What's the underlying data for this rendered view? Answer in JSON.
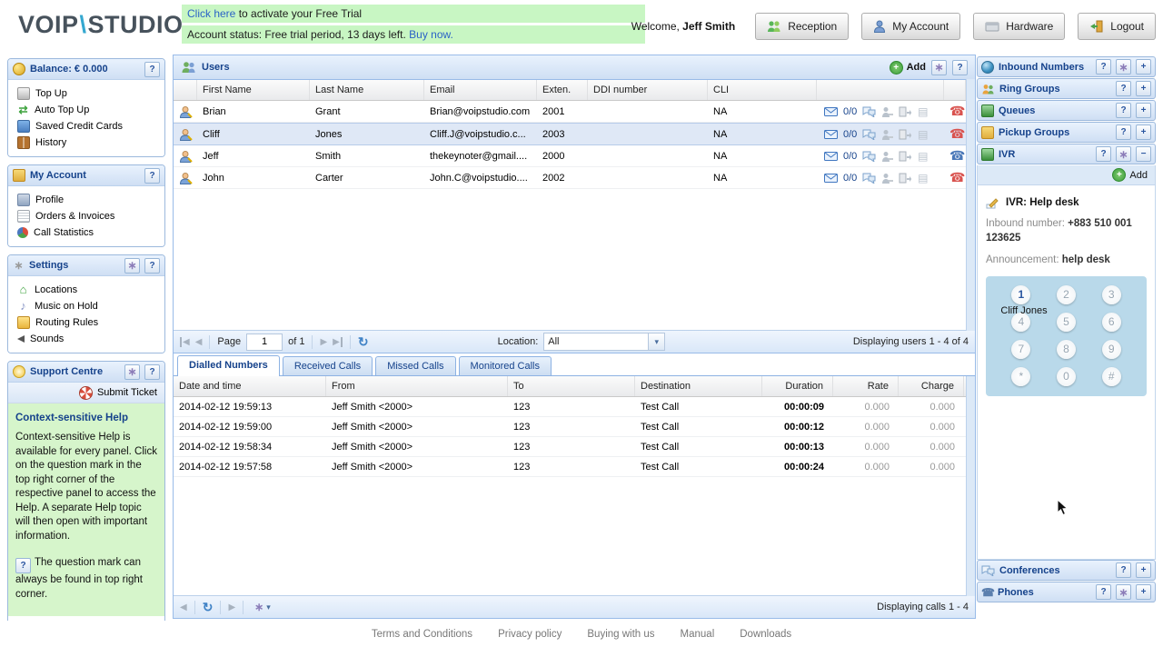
{
  "header": {
    "logo_voip": "VOIP",
    "logo_slash": "\\",
    "logo_studio": "STUDIO",
    "banner": {
      "line1_link": "Click here",
      "line1_rest": " to activate your Free Trial",
      "line2_text": "Account status: Free trial period, 13 days left.",
      "line2_link": "Buy now."
    },
    "welcome_prefix": "Welcome, ",
    "welcome_name": "Jeff Smith",
    "buttons": [
      {
        "label": "Reception"
      },
      {
        "label": "My Account"
      },
      {
        "label": "Hardware"
      },
      {
        "label": "Logout"
      }
    ]
  },
  "left_sidebar": {
    "balance": {
      "title": "Balance: € 0.000",
      "items": [
        {
          "label": "Top Up"
        },
        {
          "label": "Auto Top Up"
        },
        {
          "label": "Saved Credit Cards"
        },
        {
          "label": "History"
        }
      ]
    },
    "my_account": {
      "title": "My Account",
      "items": [
        {
          "label": "Profile"
        },
        {
          "label": "Orders & Invoices"
        },
        {
          "label": "Call Statistics"
        }
      ]
    },
    "settings": {
      "title": "Settings",
      "items": [
        {
          "label": "Locations"
        },
        {
          "label": "Music on Hold"
        },
        {
          "label": "Routing Rules"
        },
        {
          "label": "Sounds"
        }
      ]
    },
    "support": {
      "title": "Support Centre",
      "submit_ticket": "Submit Ticket",
      "help_title": "Context-sensitive Help",
      "help_body": "Context-sensitive Help is available for every panel. Click on the question mark in the top right corner of the respective panel to access the Help. A separate Help topic will then open with important information.",
      "help_note": "The question mark can always be found in top right corner."
    }
  },
  "users_panel": {
    "title": "Users",
    "add_label": "Add",
    "columns": {
      "first": "First Name",
      "last": "Last Name",
      "email": "Email",
      "ext": "Exten.",
      "ddi": "DDI number",
      "cli": "CLI"
    },
    "rows": [
      {
        "first": "Brian",
        "last": "Grant",
        "email": "Brian@voipstudio.com",
        "ext": "2001",
        "ddi": "",
        "cli": "NA",
        "vm": "0/0"
      },
      {
        "first": "Cliff",
        "last": "Jones",
        "email": "Cliff.J@voipstudio.c...",
        "ext": "2003",
        "ddi": "",
        "cli": "NA",
        "vm": "0/0"
      },
      {
        "first": "Jeff",
        "last": "Smith",
        "email": "thekeynoter@gmail....",
        "ext": "2000",
        "ddi": "",
        "cli": "NA",
        "vm": "0/0"
      },
      {
        "first": "John",
        "last": "Carter",
        "email": "John.C@voipstudio....",
        "ext": "2002",
        "ddi": "",
        "cli": "NA",
        "vm": "0/0"
      }
    ],
    "pagination": {
      "page_label": "Page",
      "page_value": "1",
      "of_label": "of 1",
      "location_label": "Location:",
      "location_value": "All",
      "status": "Displaying users 1 - 4 of 4"
    }
  },
  "calls_panel": {
    "tabs": [
      {
        "label": "Dialled Numbers"
      },
      {
        "label": "Received Calls"
      },
      {
        "label": "Missed Calls"
      },
      {
        "label": "Monitored Calls"
      }
    ],
    "columns": {
      "datetime": "Date and time",
      "from": "From",
      "to": "To",
      "destination": "Destination",
      "duration": "Duration",
      "rate": "Rate",
      "charge": "Charge"
    },
    "rows": [
      {
        "datetime": "2014-02-12 19:59:13",
        "from": "Jeff Smith <2000>",
        "to": "123",
        "destination": "Test Call",
        "duration": "00:00:09",
        "rate": "0.000",
        "charge": "0.000"
      },
      {
        "datetime": "2014-02-12 19:59:00",
        "from": "Jeff Smith <2000>",
        "to": "123",
        "destination": "Test Call",
        "duration": "00:00:12",
        "rate": "0.000",
        "charge": "0.000"
      },
      {
        "datetime": "2014-02-12 19:58:34",
        "from": "Jeff Smith <2000>",
        "to": "123",
        "destination": "Test Call",
        "duration": "00:00:13",
        "rate": "0.000",
        "charge": "0.000"
      },
      {
        "datetime": "2014-02-12 19:57:58",
        "from": "Jeff Smith <2000>",
        "to": "123",
        "destination": "Test Call",
        "duration": "00:00:24",
        "rate": "0.000",
        "charge": "0.000"
      }
    ],
    "status": "Displaying calls 1 - 4"
  },
  "right_sidebar": {
    "inbound_numbers": {
      "title": "Inbound Numbers"
    },
    "ring_groups": {
      "title": "Ring Groups"
    },
    "queues": {
      "title": "Queues"
    },
    "pickup_groups": {
      "title": "Pickup Groups"
    },
    "ivr_panel": {
      "title": "IVR",
      "add_label": "Add",
      "name": "IVR: Help desk",
      "inbound_label": "Inbound number: ",
      "inbound_value": "+883 510 001 123625",
      "announcement_label": "Announcement: ",
      "announcement_value": "help desk",
      "keys": [
        "1",
        "2",
        "3",
        "4",
        "5",
        "6",
        "7",
        "8",
        "9",
        "*",
        "0",
        "#"
      ],
      "active_key": "1",
      "active_key_user": "Cliff Jones"
    },
    "conferences": {
      "title": "Conferences"
    },
    "phones": {
      "title": "Phones"
    }
  },
  "footer": {
    "links": [
      {
        "label": "Terms and Conditions"
      },
      {
        "label": "Privacy policy"
      },
      {
        "label": "Buying with us"
      },
      {
        "label": "Manual"
      },
      {
        "label": "Downloads"
      }
    ]
  },
  "icons": {
    "help": "?",
    "add": "+",
    "minus": "−",
    "gear": "∗",
    "refresh": "↻",
    "prev": "◀",
    "next": "▶",
    "caret": "▾",
    "phone": "☎",
    "music": "♪",
    "house": "⌂",
    "recycle": "⇄",
    "keys": "▤"
  },
  "colors": {
    "accent_blue": "#15428b",
    "banner_green": "#c8f6c3",
    "help_green": "#d6f5cb",
    "selected_row": "#dfe8f6",
    "keypad_bg": "#b9d9ea",
    "link_blue": "#2b63c6",
    "logo_slash_blue": "#35a8d0",
    "phone_offline_red": "#d9534f",
    "phone_online_blue": "#4a78b8",
    "add_green": "#46a546"
  }
}
